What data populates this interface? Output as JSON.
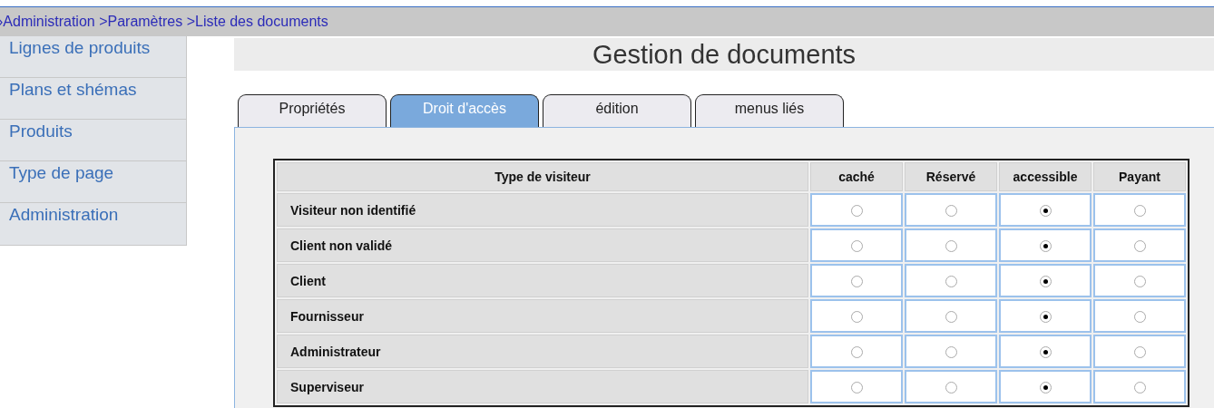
{
  "breadcrumb": "›Administration >Paramètres >Liste des documents",
  "sidebar": {
    "items": [
      {
        "label": "Lignes de produits"
      },
      {
        "label": "Plans et shémas"
      },
      {
        "label": "Produits"
      },
      {
        "label": "Type de page"
      },
      {
        "label": "Administration"
      }
    ]
  },
  "title": "Gestion de documents",
  "tabs": [
    {
      "label": "Propriétés",
      "selected": false
    },
    {
      "label": "Droit d'accès",
      "selected": true
    },
    {
      "label": "édition",
      "selected": false
    },
    {
      "label": "menus liés",
      "selected": false
    }
  ],
  "table": {
    "columns": [
      "Type de visiteur",
      "caché",
      "Réservé",
      "accessible",
      "Payant"
    ],
    "rows": [
      {
        "label": "Visiteur non identifié",
        "options": [
          {
            "selected": false
          },
          {
            "selected": false
          },
          {
            "selected": true
          },
          {
            "selected": false
          }
        ]
      },
      {
        "label": "Client non validé",
        "options": [
          {
            "selected": false
          },
          {
            "selected": false
          },
          {
            "selected": true
          },
          {
            "selected": false
          }
        ]
      },
      {
        "label": "Client",
        "options": [
          {
            "selected": false
          },
          {
            "selected": false
          },
          {
            "selected": true
          },
          {
            "selected": false
          }
        ]
      },
      {
        "label": "Fournisseur",
        "options": [
          {
            "selected": false
          },
          {
            "selected": false
          },
          {
            "selected": true
          },
          {
            "selected": false
          }
        ]
      },
      {
        "label": "Administrateur",
        "options": [
          {
            "selected": false
          },
          {
            "selected": false
          },
          {
            "selected": true
          },
          {
            "selected": false
          }
        ]
      },
      {
        "label": "Superviseur",
        "options": [
          {
            "selected": false
          },
          {
            "selected": false
          },
          {
            "selected": true
          },
          {
            "selected": false
          }
        ]
      }
    ]
  }
}
